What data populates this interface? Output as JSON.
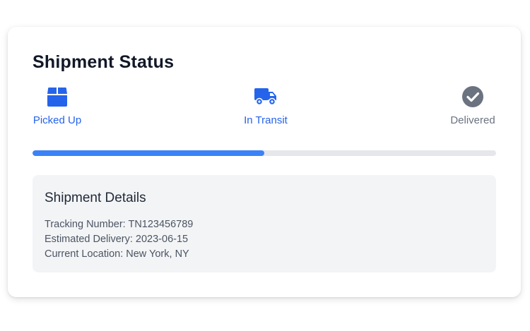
{
  "title": "Shipment Status",
  "steps": [
    {
      "label": "Picked Up",
      "icon": "box-icon",
      "state": "complete"
    },
    {
      "label": "In Transit",
      "icon": "truck-icon",
      "state": "current"
    },
    {
      "label": "Delivered",
      "icon": "check-circle-icon",
      "state": "pending"
    }
  ],
  "progress": {
    "percent": 50
  },
  "details": {
    "heading": "Shipment Details",
    "tracking": "Tracking Number: TN123456789",
    "estimated_delivery": "Estimated Delivery: 2023-06-15",
    "current_location": "Current Location: New York, NY"
  },
  "colors": {
    "accent": "#2563eb",
    "progress_fill": "#3b82f6",
    "progress_track": "#e5e7eb",
    "inactive": "#6b7280",
    "details_bg": "#f3f4f6"
  }
}
